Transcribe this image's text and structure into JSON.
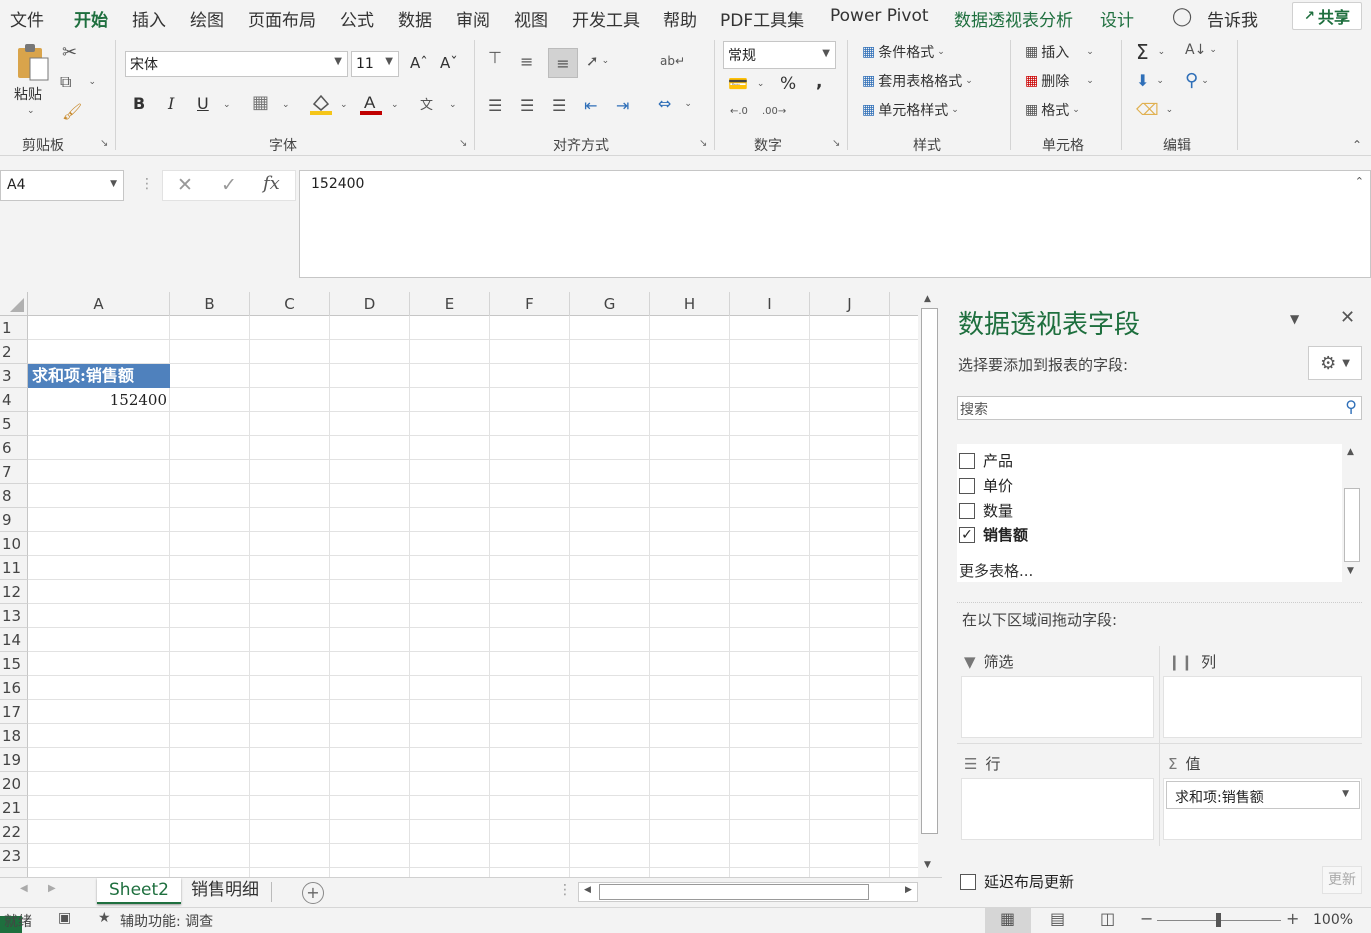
{
  "menu": {
    "tabs": [
      "文件",
      "开始",
      "插入",
      "绘图",
      "页面布局",
      "公式",
      "数据",
      "审阅",
      "视图",
      "开发工具",
      "帮助",
      "PDF工具集",
      "Power Pivot",
      "数据透视表分析",
      "设计"
    ],
    "active": "开始",
    "tell_me": "告诉我",
    "share": "共享"
  },
  "ribbon": {
    "clipboard": {
      "paste": "粘贴",
      "label": "剪贴板"
    },
    "font": {
      "family": "宋体",
      "size": "11",
      "bold": "B",
      "italic": "I",
      "underline": "U",
      "label": "字体"
    },
    "alignment": {
      "label": "对齐方式"
    },
    "number": {
      "format": "常规",
      "percent": "%",
      "comma": ",",
      "label": "数字"
    },
    "styles": {
      "conditional": "条件格式",
      "table": "套用表格格式",
      "cell": "单元格样式",
      "label": "样式"
    },
    "cells": {
      "insert": "插入",
      "delete": "删除",
      "format": "格式",
      "label": "单元格"
    },
    "editing": {
      "label": "编辑"
    }
  },
  "formula_bar": {
    "name_box": "A4",
    "value": "152400"
  },
  "sheet": {
    "columns": [
      "A",
      "B",
      "C",
      "D",
      "E",
      "F",
      "G",
      "H",
      "I",
      "J"
    ],
    "rows": [
      "1",
      "2",
      "3",
      "4",
      "5",
      "6",
      "7",
      "8",
      "9",
      "10",
      "11",
      "12",
      "13",
      "14",
      "15",
      "16",
      "17",
      "18",
      "19",
      "20",
      "21",
      "22",
      "23"
    ],
    "pivot_header": "求和项:销售额",
    "pivot_value": "152400"
  },
  "sheet_tabs": [
    "Sheet2",
    "销售明细"
  ],
  "status": {
    "ready": "就绪",
    "accessibility": "辅助功能: 调查",
    "zoom": "100%"
  },
  "pane": {
    "title": "数据透视表字段",
    "subtitle": "选择要添加到报表的字段:",
    "search_placeholder": "搜索",
    "fields": [
      {
        "name": "产品",
        "checked": false
      },
      {
        "name": "单价",
        "checked": false
      },
      {
        "name": "数量",
        "checked": false
      },
      {
        "name": "销售额",
        "checked": true
      }
    ],
    "more_tables": "更多表格...",
    "areas_title": "在以下区域间拖动字段:",
    "filter": "筛选",
    "columns": "列",
    "rows": "行",
    "values": "值",
    "value_item": "求和项:销售额",
    "defer": "延迟布局更新",
    "update": "更新"
  }
}
